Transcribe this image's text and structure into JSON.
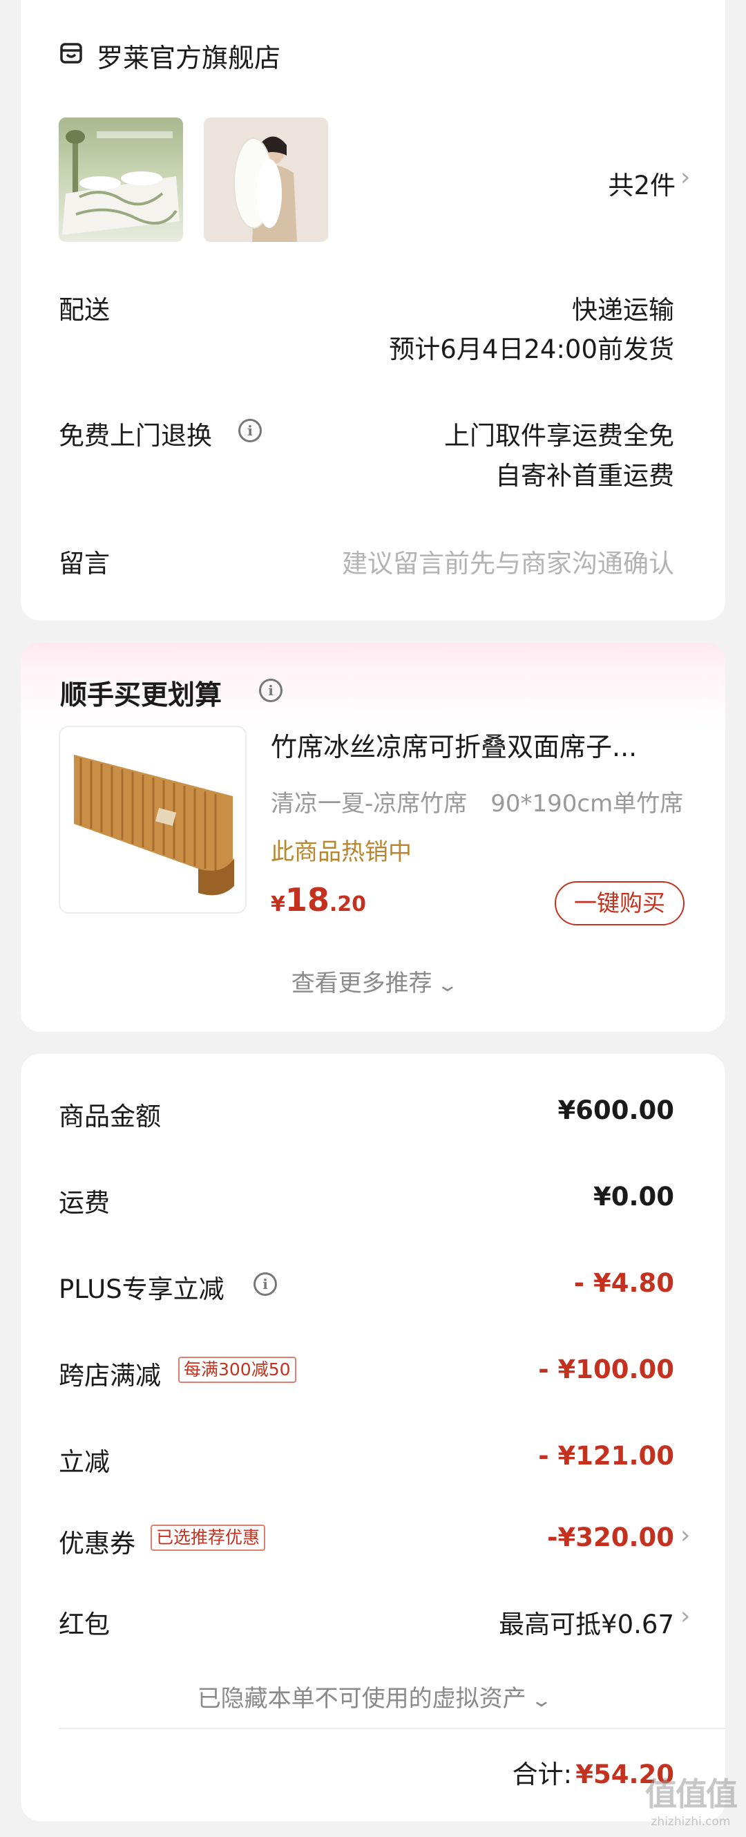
{
  "store": {
    "name": "罗莱官方旗舰店",
    "item_count": "共2件"
  },
  "delivery": {
    "label": "配送",
    "method": "快递运输",
    "eta": "预计6月4日24:00前发货"
  },
  "returns": {
    "label": "免费上门退换",
    "line1": "上门取件享运费全免",
    "line2": "自寄补首重运费"
  },
  "message": {
    "label": "留言",
    "placeholder": "建议留言前先与商家沟通确认"
  },
  "recommend": {
    "title": "顺手买更划算",
    "product_title": "竹席冰丝凉席可折叠双面席子...",
    "spec": "清凉一夏-凉席竹席　90*190cm单竹席",
    "hot": "此商品热销中",
    "price_symbol": "¥",
    "price_int": "18",
    "price_dec": ".20",
    "buy_label": "一键购买",
    "more": "查看更多推荐"
  },
  "summary": {
    "rows": [
      {
        "label": "商品金额",
        "value": "¥600.00"
      },
      {
        "label": "运费",
        "value": "¥0.00"
      },
      {
        "label": "PLUS专享立减",
        "value": "- ¥4.80"
      },
      {
        "label": "跨店满减",
        "tag": "每满300减50",
        "value": "- ¥100.00"
      },
      {
        "label": "立减",
        "value": "- ¥121.00"
      },
      {
        "label": "优惠券",
        "tag": "已选推荐优惠",
        "value": "-¥320.00"
      },
      {
        "label": "红包",
        "value": "最高可抵¥0.67"
      }
    ],
    "hidden_note": "已隐藏本单不可使用的虚拟资产",
    "total_label": "合计:",
    "total_value": "¥54.20"
  },
  "watermark": {
    "logo": "值值值",
    "site": "zhizhizhi.com"
  },
  "colors": {
    "accent_red": "#c4321f",
    "hot_gold": "#b8862e",
    "tag_border": "#e07f6f"
  }
}
